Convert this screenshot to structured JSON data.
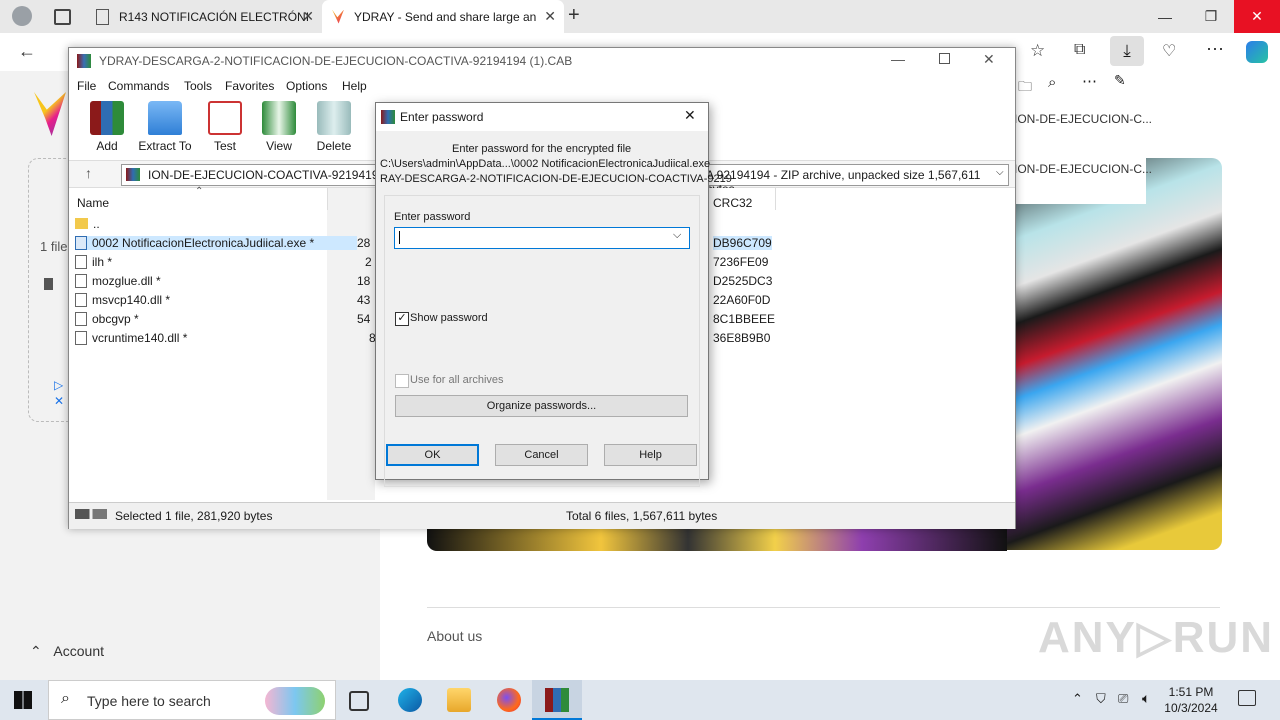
{
  "browser": {
    "tabs": [
      {
        "title": "R143 NOTIFICACIÓN ELECTRÓNI",
        "active": false
      },
      {
        "title": "YDRAY - Send and share large an",
        "active": true
      }
    ],
    "new_tab": "+",
    "window_controls": {
      "minimize": "—",
      "maximize": "❐",
      "close": "✕"
    }
  },
  "page": {
    "one_file": "1 file",
    "account": "Account",
    "about_us": "About us",
    "behind_text_1": "ION-DE-EJECUCION-C...",
    "behind_text_2": "ION-DE-EJECUCION-C...",
    "watermark": "ANY▷RUN"
  },
  "winrar": {
    "title": "YDRAY-DESCARGA-2-NOTIFICACION-DE-EJECUCION-COACTIVA-92194194 (1).CAB",
    "menu": [
      "File",
      "Commands",
      "Tools",
      "Favorites",
      "Options",
      "Help"
    ],
    "toolbar": [
      "Add",
      "Extract To",
      "Test",
      "View",
      "Delete"
    ],
    "path_left": "ION-DE-EJECUCION-COACTIVA-92194194 (",
    "path_right": "A 92194194 - ZIP archive, unpacked size 1,567,611 bytes",
    "columns": {
      "name": "Name",
      "crc": "CRC32"
    },
    "files": [
      {
        "name": "..",
        "size": "",
        "crc": ""
      },
      {
        "name": "0002 NotificacionElectronicaJudiical.exe *",
        "size": "28",
        "crc": "DB96C709"
      },
      {
        "name": "ilh *",
        "size": "2",
        "crc": "7236FE09"
      },
      {
        "name": "mozglue.dll *",
        "size": "18",
        "crc": "D2525DC3"
      },
      {
        "name": "msvcp140.dll *",
        "size": "43",
        "crc": "22A60F0D"
      },
      {
        "name": "obcgvp *",
        "size": "54",
        "crc": "8C1BBEEE"
      },
      {
        "name": "vcruntime140.dll *",
        "size": "8",
        "crc": "36E8B9B0"
      }
    ],
    "status_left": "Selected 1 file, 281,920 bytes",
    "status_right": "Total 6 files, 1,567,611 bytes"
  },
  "dialog": {
    "title": "Enter password",
    "line1": "Enter password for the encrypted file",
    "line2": "C:\\Users\\admin\\AppData...\\0002 NotificacionElectronicaJudiical.exe",
    "line3": "RAY-DESCARGA-2-NOTIFICACION-DE-EJECUCION-COACTIVA-9219",
    "field_label": "Enter password",
    "password_value": "",
    "show_password": "Show password",
    "show_password_checked": true,
    "use_all": "Use for all archives",
    "organize": "Organize passwords...",
    "ok": "OK",
    "cancel": "Cancel",
    "help": "Help"
  },
  "taskbar": {
    "search_placeholder": "Type here to search",
    "time": "1:51 PM",
    "date": "10/3/2024"
  }
}
